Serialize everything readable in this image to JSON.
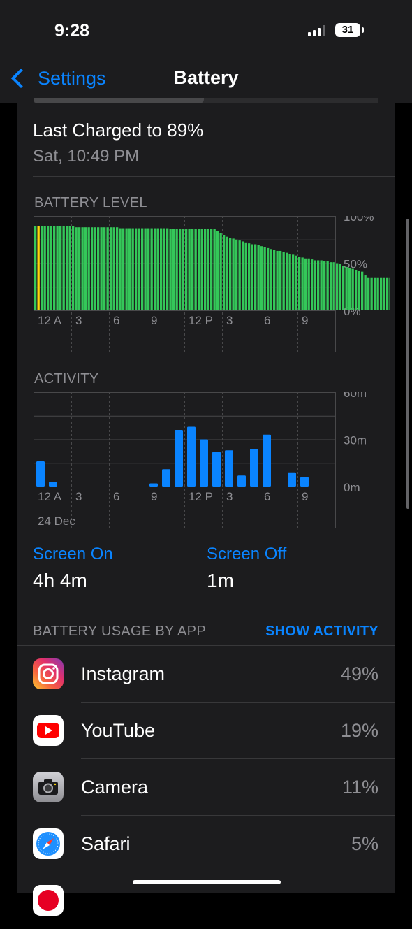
{
  "status": {
    "time": "9:28",
    "battery": "31"
  },
  "nav": {
    "back_label": "Settings",
    "title": "Battery"
  },
  "last_charged": {
    "title": "Last Charged to 89%",
    "date": "Sat, 10:49 PM"
  },
  "battery_level": {
    "label": "BATTERY LEVEL",
    "y_ticks": [
      "100%",
      "50%",
      "0%"
    ],
    "x_ticks": [
      "12 A",
      "3",
      "6",
      "9",
      "12 P",
      "3",
      "6",
      "9"
    ]
  },
  "activity": {
    "label": "ACTIVITY",
    "y_ticks": [
      "60m",
      "30m",
      "0m"
    ],
    "x_ticks": [
      "12 A",
      "3",
      "6",
      "9",
      "12 P",
      "3",
      "6",
      "9"
    ],
    "date": "24 Dec"
  },
  "screen_on": {
    "label": "Screen On",
    "value": "4h 4m"
  },
  "screen_off": {
    "label": "Screen Off",
    "value": "1m"
  },
  "usage": {
    "header": "BATTERY USAGE BY APP",
    "show_activity": "SHOW ACTIVITY",
    "apps": [
      {
        "name": "Instagram",
        "percent": "49%",
        "icon": "instagram-icon"
      },
      {
        "name": "YouTube",
        "percent": "19%",
        "icon": "youtube-icon"
      },
      {
        "name": "Camera",
        "percent": "11%",
        "icon": "camera-icon"
      },
      {
        "name": "Safari",
        "percent": "5%",
        "icon": "safari-icon"
      }
    ]
  },
  "colors": {
    "accent": "#0a84ff",
    "battery_green": "#34c759",
    "charging_yellow": "#ffd60a",
    "activity_blue": "#0a84ff"
  },
  "chart_data": [
    {
      "type": "bar",
      "title": "BATTERY LEVEL",
      "x_unit": "hour of day (0 = 12 A)",
      "x_start": 0,
      "x_step": 0.25,
      "ylim": [
        0,
        100
      ],
      "charging_bars": [
        1
      ],
      "values": [
        89,
        89,
        89,
        89,
        89,
        89,
        89,
        89,
        89,
        89,
        89,
        89,
        89,
        88,
        88,
        88,
        88,
        88,
        88,
        88,
        88,
        88,
        88,
        88,
        88,
        88,
        88,
        87,
        87,
        87,
        87,
        87,
        87,
        87,
        87,
        87,
        87,
        87,
        87,
        87,
        87,
        87,
        87,
        86,
        86,
        86,
        86,
        86,
        86,
        86,
        86,
        86,
        86,
        86,
        86,
        86,
        86,
        86,
        84,
        82,
        80,
        78,
        77,
        76,
        75,
        74,
        73,
        72,
        71,
        70,
        70,
        69,
        68,
        67,
        66,
        65,
        64,
        63,
        63,
        62,
        61,
        60,
        59,
        58,
        57,
        56,
        55,
        55,
        54,
        53,
        53,
        53,
        52,
        52,
        51,
        51,
        50,
        49,
        47,
        46,
        45,
        44,
        43,
        42,
        41,
        37,
        35,
        35,
        35,
        35,
        35,
        35,
        35,
        35,
        35,
        35,
        33,
        32,
        31
      ]
    },
    {
      "type": "bar",
      "title": "ACTIVITY",
      "x_unit": "hour of day (0 = 12 A)",
      "categories": [
        "0",
        "1",
        "2",
        "3",
        "4",
        "5",
        "6",
        "7",
        "8",
        "9",
        "10",
        "11",
        "12",
        "13",
        "14",
        "15",
        "16",
        "17",
        "18",
        "19",
        "20",
        "21"
      ],
      "values": [
        16,
        3,
        0,
        0,
        0,
        0,
        0,
        0,
        0,
        2,
        11,
        36,
        38,
        30,
        22,
        23,
        7,
        24,
        33,
        0,
        9,
        6
      ],
      "unit": "m",
      "ylim": [
        0,
        60
      ]
    }
  ]
}
